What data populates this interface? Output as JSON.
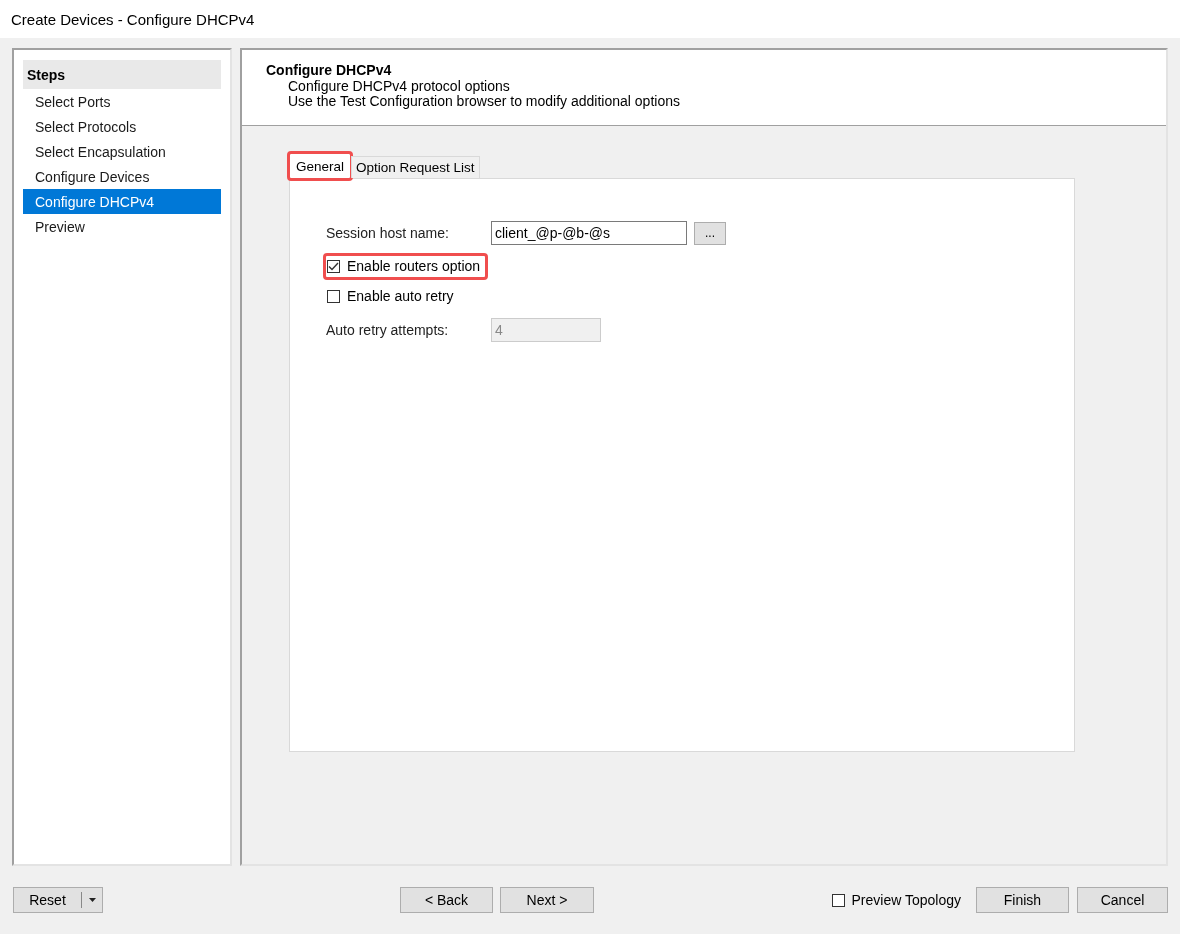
{
  "window": {
    "title": "Create Devices - Configure DHCPv4"
  },
  "steps": {
    "heading": "Steps",
    "items": [
      {
        "label": "Select Ports",
        "selected": false
      },
      {
        "label": "Select Protocols",
        "selected": false
      },
      {
        "label": "Select Encapsulation",
        "selected": false
      },
      {
        "label": "Configure Devices",
        "selected": false
      },
      {
        "label": "Configure DHCPv4",
        "selected": true
      },
      {
        "label": "Preview",
        "selected": false
      }
    ]
  },
  "header": {
    "title": "Configure DHCPv4",
    "lines": [
      "Configure DHCPv4 protocol options",
      "Use the Test Configuration browser to modify additional options"
    ]
  },
  "tabs": [
    {
      "label": "General",
      "selected": true,
      "highlighted": true
    },
    {
      "label": "Option Request List",
      "selected": false,
      "highlighted": false
    }
  ],
  "form": [
    {
      "kind": "text",
      "label": "Session host name:",
      "value": "client_@p-@b-@s",
      "button": "...",
      "disabled": false
    },
    {
      "kind": "checkbox",
      "label": "Enable routers option",
      "checked": true,
      "highlighted": true
    },
    {
      "kind": "checkbox",
      "label": "Enable auto retry",
      "checked": false,
      "highlighted": false
    },
    {
      "kind": "text",
      "label": "Auto retry attempts:",
      "value": "4",
      "disabled": true
    }
  ],
  "footer": {
    "reset": "Reset",
    "back": "< Back",
    "next": "Next >",
    "preview_topology": {
      "label": "Preview Topology",
      "checked": false
    },
    "finish": "Finish",
    "cancel": "Cancel"
  }
}
